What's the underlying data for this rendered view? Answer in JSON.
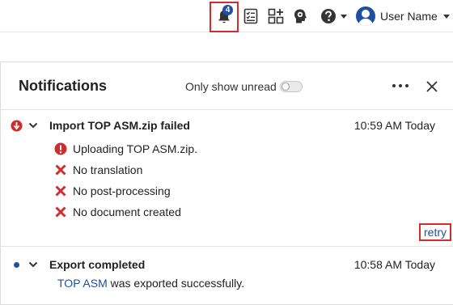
{
  "topbar": {
    "notification_count": "4",
    "user_name": "User Name"
  },
  "panel": {
    "title": "Notifications",
    "only_unread_label": "Only show unread",
    "only_unread_enabled": false
  },
  "notifications": [
    {
      "title": "Import TOP ASM.zip failed",
      "time": "10:59 AM Today",
      "status": "error",
      "steps": [
        {
          "status": "error",
          "text": "Uploading TOP ASM.zip."
        },
        {
          "status": "failed",
          "text": "No translation"
        },
        {
          "status": "failed",
          "text": "No post-processing"
        },
        {
          "status": "failed",
          "text": "No document created"
        }
      ],
      "action_label": "retry"
    },
    {
      "title": "Export completed",
      "time": "10:58 AM Today",
      "status": "unread",
      "link_text": "TOP ASM",
      "description_suffix": " was exported successfully."
    }
  ],
  "colors": {
    "accent": "#1f4fa0",
    "error": "#cc2d2d",
    "highlight_border": "#d62b2b"
  }
}
